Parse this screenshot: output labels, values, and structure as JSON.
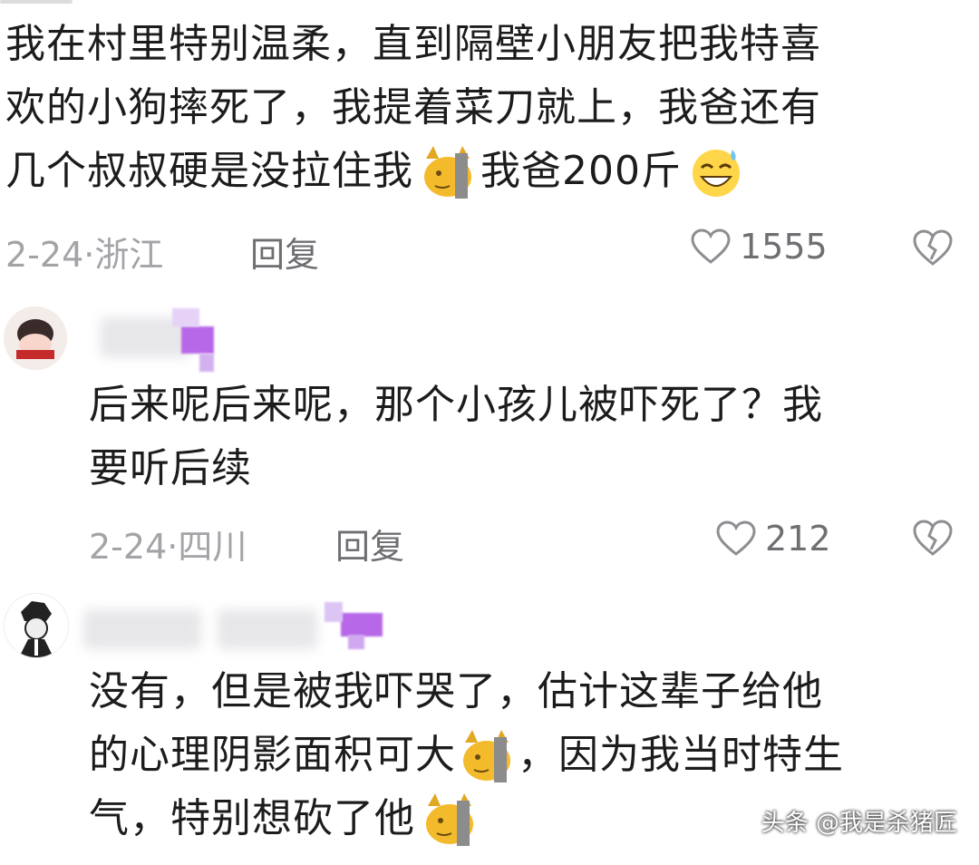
{
  "comments": [
    {
      "text_lines": [
        "我在村里特别温柔，直到隔壁小朋友把我特喜",
        "欢的小狗摔死了，我提着菜刀就上，我爸还有",
        "几个叔叔硬是没拉住我",
        "我爸200斤"
      ],
      "date": "2-24",
      "location": "浙江",
      "reply_label": "回复",
      "likes": "1555"
    },
    {
      "text_lines": [
        "后来呢后来呢，那个小孩儿被吓死了？我",
        "要听后续"
      ],
      "date": "2-24",
      "location": "四川",
      "reply_label": "回复",
      "likes": "212"
    },
    {
      "text_lines": [
        "没有，但是被我吓哭了，估计这辈子给他",
        "的心理阴影面积可大",
        "，因为我当时特生",
        "气，特别想砍了他"
      ]
    }
  ],
  "watermark": "头条 @我是杀猪匠",
  "icons": {
    "heart": "heart-outline-icon",
    "dislike": "broken-heart-icon",
    "emoji_cat": "cat-facepalm-emoji",
    "emoji_laugh": "laugh-sweat-emoji"
  },
  "colors": {
    "text": "#1c1c1e",
    "meta": "#a3a3a8",
    "purple": "#b768e8"
  }
}
